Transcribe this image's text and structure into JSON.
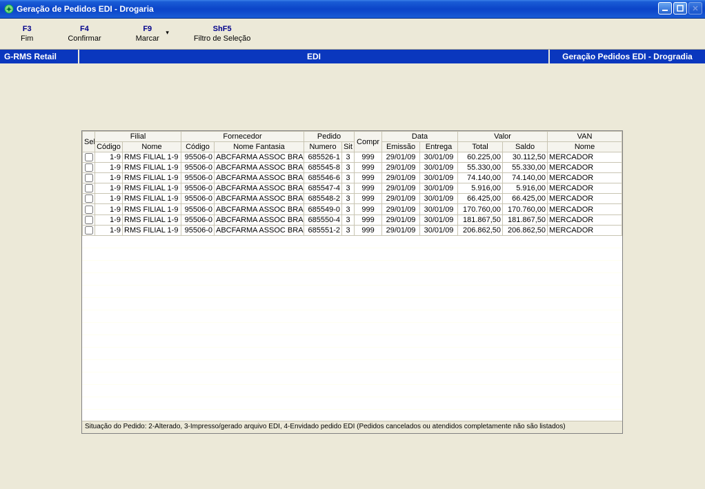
{
  "window": {
    "title": "Geração de Pedidos EDI - Drogaria"
  },
  "toolbar": {
    "items": [
      {
        "key": "F3",
        "label": "Fim"
      },
      {
        "key": "F4",
        "label": "Confirmar"
      },
      {
        "key": "F9",
        "label": "Marcar",
        "dropdown": true
      },
      {
        "key": "ShF5",
        "label": "Filtro de Seleção"
      }
    ]
  },
  "breadcrumb": {
    "left": "G-RMS Retail",
    "mid": "EDI",
    "right": "Geração Pedidos EDI - Drogradia"
  },
  "grid": {
    "groups": {
      "sel": "Sel",
      "filial": "Filial",
      "fornecedor": "Fornecedor",
      "pedido": "Pedido",
      "compr": "Compr",
      "data": "Data",
      "valor": "Valor",
      "van": "VAN"
    },
    "cols": {
      "filial_codigo": "Código",
      "filial_nome": "Nome",
      "forn_codigo": "Código",
      "forn_nome": "Nome Fantasia",
      "pedido_numero": "Numero",
      "pedido_sit": "Sit",
      "data_emissao": "Emissão",
      "data_entrega": "Entrega",
      "valor_total": "Total",
      "valor_saldo": "Saldo",
      "van_nome": "Nome"
    },
    "rows": [
      {
        "filial_codigo": "1-9",
        "filial_nome": "RMS FILIAL 1-9",
        "forn_codigo": "95506-0",
        "forn_nome": "ABCFARMA ASSOC BRAS",
        "pedido_numero": "685526-1",
        "sit": "3",
        "compr": "999",
        "emissao": "29/01/09",
        "entrega": "30/01/09",
        "total": "60.225,00",
        "saldo": "30.112,50",
        "van": "MERCADOR"
      },
      {
        "filial_codigo": "1-9",
        "filial_nome": "RMS FILIAL 1-9",
        "forn_codigo": "95506-0",
        "forn_nome": "ABCFARMA ASSOC BRAS",
        "pedido_numero": "685545-8",
        "sit": "3",
        "compr": "999",
        "emissao": "29/01/09",
        "entrega": "30/01/09",
        "total": "55.330,00",
        "saldo": "55.330,00",
        "van": "MERCADOR"
      },
      {
        "filial_codigo": "1-9",
        "filial_nome": "RMS FILIAL 1-9",
        "forn_codigo": "95506-0",
        "forn_nome": "ABCFARMA ASSOC BRAS",
        "pedido_numero": "685546-6",
        "sit": "3",
        "compr": "999",
        "emissao": "29/01/09",
        "entrega": "30/01/09",
        "total": "74.140,00",
        "saldo": "74.140,00",
        "van": "MERCADOR"
      },
      {
        "filial_codigo": "1-9",
        "filial_nome": "RMS FILIAL 1-9",
        "forn_codigo": "95506-0",
        "forn_nome": "ABCFARMA ASSOC BRAS",
        "pedido_numero": "685547-4",
        "sit": "3",
        "compr": "999",
        "emissao": "29/01/09",
        "entrega": "30/01/09",
        "total": "5.916,00",
        "saldo": "5.916,00",
        "van": "MERCADOR"
      },
      {
        "filial_codigo": "1-9",
        "filial_nome": "RMS FILIAL 1-9",
        "forn_codigo": "95506-0",
        "forn_nome": "ABCFARMA ASSOC BRAS",
        "pedido_numero": "685548-2",
        "sit": "3",
        "compr": "999",
        "emissao": "29/01/09",
        "entrega": "30/01/09",
        "total": "66.425,00",
        "saldo": "66.425,00",
        "van": "MERCADOR"
      },
      {
        "filial_codigo": "1-9",
        "filial_nome": "RMS FILIAL 1-9",
        "forn_codigo": "95506-0",
        "forn_nome": "ABCFARMA ASSOC BRAS",
        "pedido_numero": "685549-0",
        "sit": "3",
        "compr": "999",
        "emissao": "29/01/09",
        "entrega": "30/01/09",
        "total": "170.760,00",
        "saldo": "170.760,00",
        "van": "MERCADOR"
      },
      {
        "filial_codigo": "1-9",
        "filial_nome": "RMS FILIAL 1-9",
        "forn_codigo": "95506-0",
        "forn_nome": "ABCFARMA ASSOC BRAS",
        "pedido_numero": "685550-4",
        "sit": "3",
        "compr": "999",
        "emissao": "29/01/09",
        "entrega": "30/01/09",
        "total": "181.867,50",
        "saldo": "181.867,50",
        "van": "MERCADOR"
      },
      {
        "filial_codigo": "1-9",
        "filial_nome": "RMS FILIAL 1-9",
        "forn_codigo": "95506-0",
        "forn_nome": "ABCFARMA ASSOC BRAS",
        "pedido_numero": "685551-2",
        "sit": "3",
        "compr": "999",
        "emissao": "29/01/09",
        "entrega": "30/01/09",
        "total": "206.862,50",
        "saldo": "206.862,50",
        "van": "MERCADOR"
      }
    ]
  },
  "footer": {
    "text": "Situação do Pedido: 2-Alterado, 3-Impresso/gerado arquivo EDI, 4-Envidado pedido EDI    (Pedidos cancelados ou atendidos completamente não são listados)"
  }
}
